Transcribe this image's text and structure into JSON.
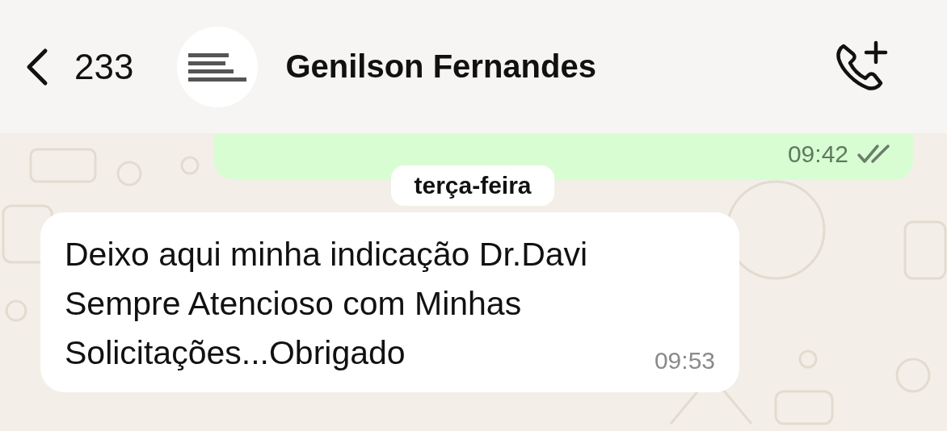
{
  "header": {
    "back_count": "233",
    "contact_name": "Genilson Fernandes"
  },
  "messages": [
    {
      "kind": "outgoing",
      "time": "09:42",
      "read": false
    },
    {
      "kind": "date",
      "text": "terça-feira"
    },
    {
      "kind": "incoming",
      "text": "Deixo aqui minha indicação Dr.Davi Sempre Atencioso com Minhas Solicitações...Obrigado",
      "time": "09:53"
    }
  ]
}
